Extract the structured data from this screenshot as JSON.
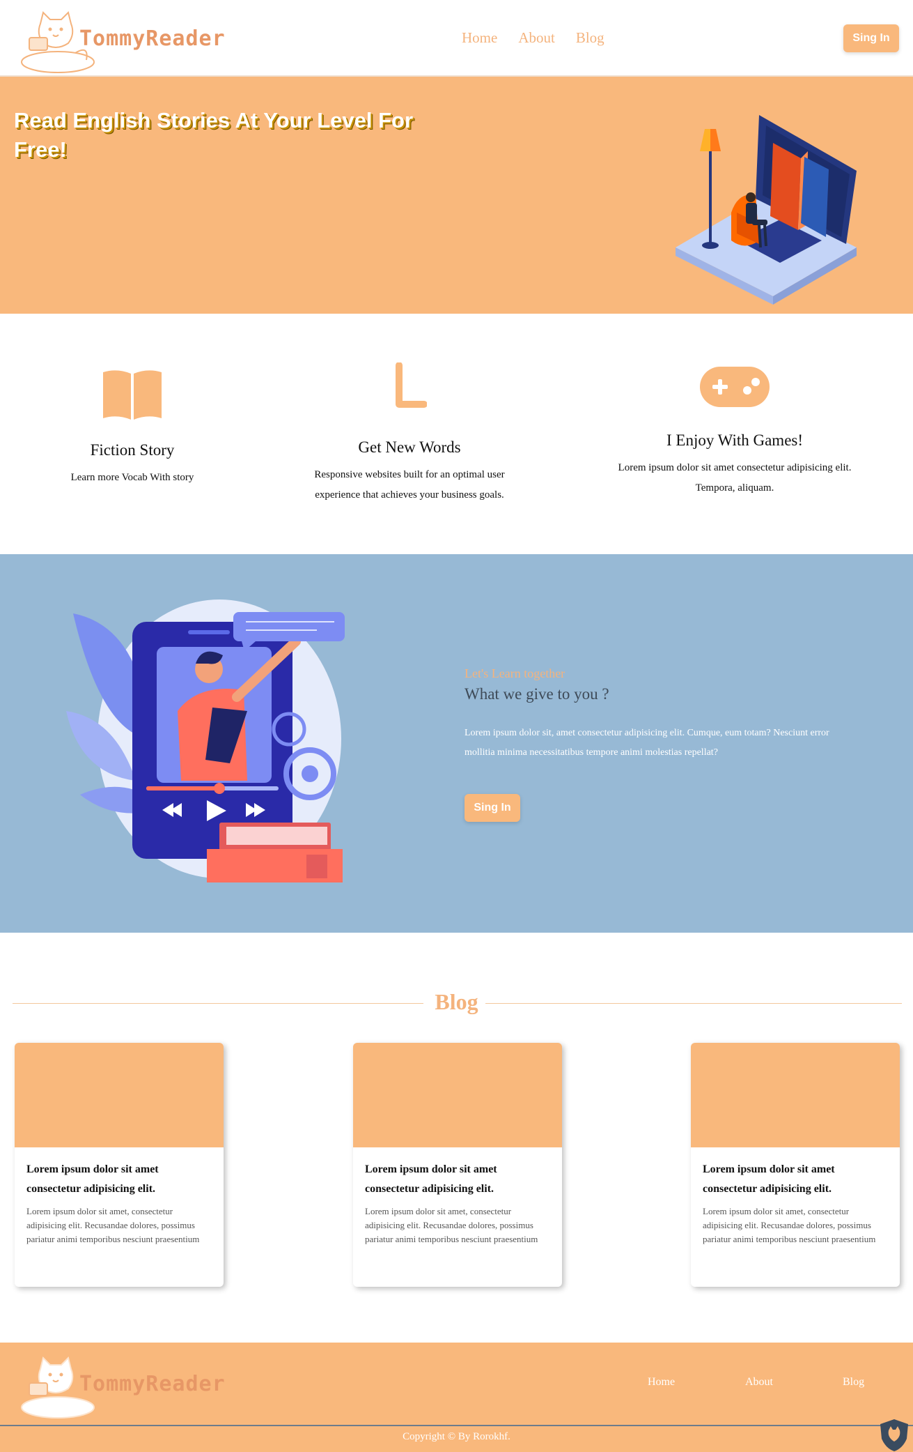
{
  "header": {
    "logo_text": "TommyReader",
    "nav": [
      "Home",
      "About",
      "Blog"
    ],
    "signin_label": "Sing In"
  },
  "hero": {
    "title": "Read English Stories At Your Level For Free!"
  },
  "features": [
    {
      "title": "Fiction Story",
      "text": "Learn more Vocab With story",
      "icon": "book-open-icon"
    },
    {
      "title": "Get New Words",
      "text": "Responsive websites built for an optimal user experience that achieves your business goals.",
      "icon": "letter-l-icon"
    },
    {
      "title": "I Enjoy With Games!",
      "text": "Lorem ipsum dolor sit amet consectetur adipisicing elit. Tempora, aliquam.",
      "icon": "gamepad-icon"
    }
  ],
  "learn": {
    "subtitle": "Let's Learn together",
    "title": "What we give to you ?",
    "text": "Lorem ipsum dolor sit, amet consectetur adipisicing elit. Cumque, eum totam? Nesciunt error mollitia minima necessitatibus tempore animi molestias repellat?",
    "signin_label": "Sing In"
  },
  "blog": {
    "heading": "Blog",
    "cards": [
      {
        "title": "Lorem ipsum dolor sit amet consectetur adipisicing elit.",
        "text": "Lorem ipsum dolor sit amet, consectetur adipisicing elit. Recusandae dolores, possimus pariatur animi temporibus nesciunt praesentium"
      },
      {
        "title": "Lorem ipsum dolor sit amet consectetur adipisicing elit.",
        "text": "Lorem ipsum dolor sit amet, consectetur adipisicing elit. Recusandae dolores, possimus pariatur animi temporibus nesciunt praesentium"
      },
      {
        "title": "Lorem ipsum dolor sit amet consectetur adipisicing elit.",
        "text": "Lorem ipsum dolor sit amet, consectetur adipisicing elit. Recusandae dolores, possimus pariatur animi temporibus nesciunt praesentium"
      }
    ]
  },
  "footer": {
    "logo_text": "TommyReader",
    "links": [
      "Home",
      "About",
      "Blog"
    ],
    "copyright": "Copyright © By Rorokhf."
  },
  "colors": {
    "accent": "#f9b87c",
    "learn_bg": "#97b9d5",
    "logo_text": "#e79766"
  }
}
